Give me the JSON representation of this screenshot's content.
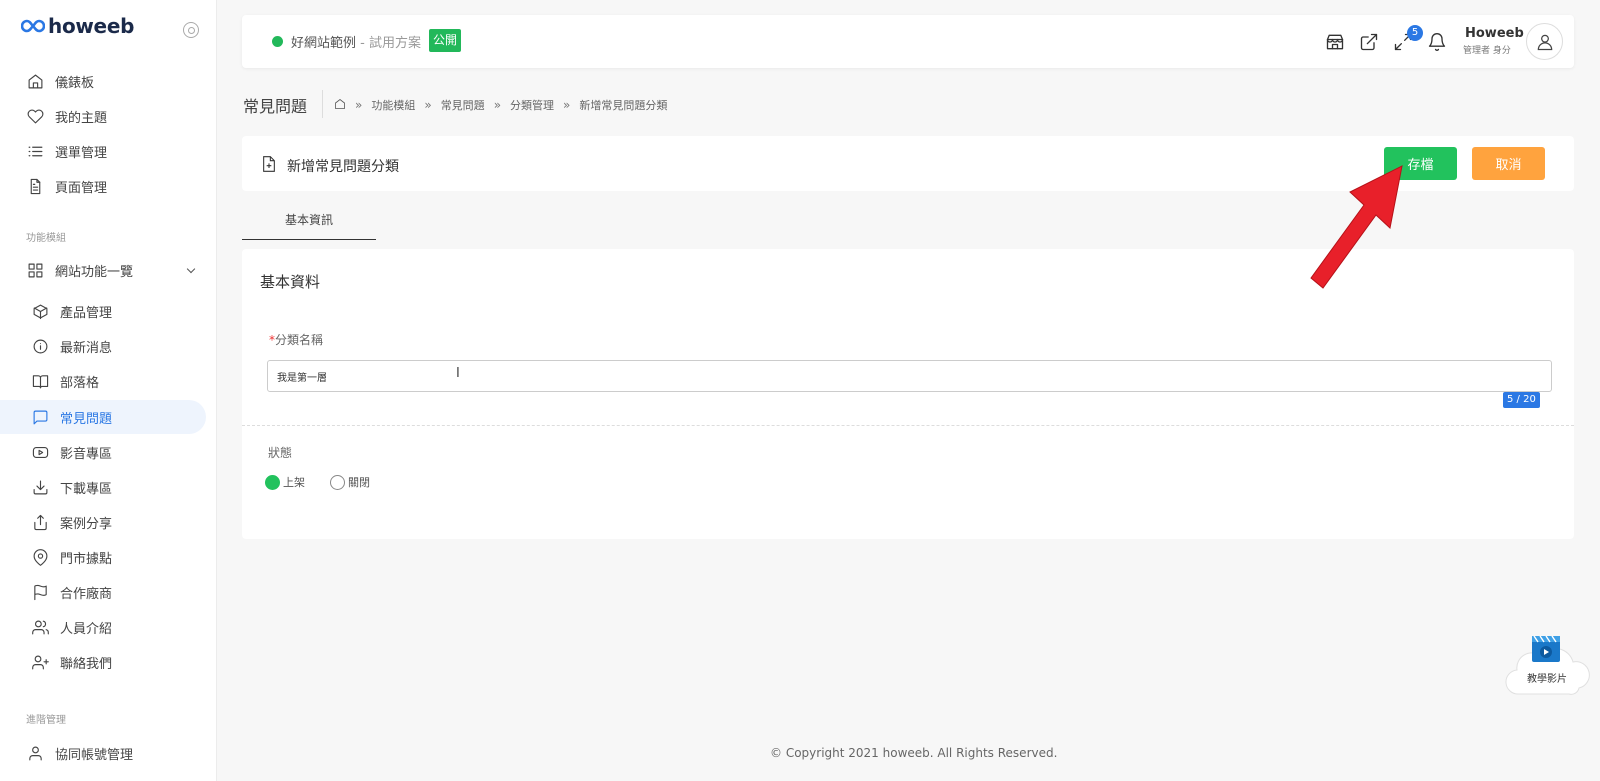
{
  "logo": {
    "text": "howeeb"
  },
  "sidebar": {
    "items": [
      {
        "label": "儀錶板",
        "icon": "home-icon"
      },
      {
        "label": "我的主題",
        "icon": "heart-icon"
      },
      {
        "label": "選單管理",
        "icon": "list-icon"
      },
      {
        "label": "頁面管理",
        "icon": "file-text-icon"
      }
    ],
    "group_modules": "功能模組",
    "site_functions": "網站功能一覽",
    "modules": [
      {
        "label": "產品管理",
        "icon": "box-icon"
      },
      {
        "label": "最新消息",
        "icon": "info-icon"
      },
      {
        "label": "部落格",
        "icon": "book-icon"
      },
      {
        "label": "常見問題",
        "icon": "message-icon",
        "active": true
      },
      {
        "label": "影音專區",
        "icon": "youtube-icon"
      },
      {
        "label": "下載專區",
        "icon": "download-icon"
      },
      {
        "label": "案例分享",
        "icon": "share-icon"
      },
      {
        "label": "門市據點",
        "icon": "map-pin-icon"
      },
      {
        "label": "合作廠商",
        "icon": "flag-icon"
      },
      {
        "label": "人員介紹",
        "icon": "users-icon"
      },
      {
        "label": "聯絡我們",
        "icon": "user-plus-icon"
      }
    ],
    "group_advanced": "進階管理",
    "co_account": "協同帳號管理"
  },
  "topbar": {
    "site_name": "好網站範例",
    "site_plan": " - 試用方案",
    "public_badge": "公開",
    "bell_count": "5",
    "user_name": "Howeeb",
    "user_role": "管理者 身分"
  },
  "page": {
    "title": "常見問題",
    "breadcrumb": [
      "功能模組",
      "常見問題",
      "分類管理",
      "新增常見問題分類"
    ]
  },
  "card": {
    "title": "新增常見問題分類",
    "save_label": "存檔",
    "cancel_label": "取消"
  },
  "tabs": [
    {
      "label": "基本資訊"
    }
  ],
  "form": {
    "section_title": "基本資料",
    "required_mark": "*",
    "name_label": "分類名稱",
    "name_value": "我是第一層",
    "char_count": "5 / 20",
    "status_label": "狀態",
    "status_options": [
      "上架",
      "關閉"
    ],
    "status_selected": "上架"
  },
  "footer": {
    "text": "© Copyright 2021 howeeb. All Rights Reserved."
  },
  "tutorial": {
    "label": "教學影片"
  },
  "colors": {
    "primary": "#2b78e4",
    "success": "#22c25d",
    "warning": "#ffa33e",
    "arrow": "#e8202a"
  }
}
